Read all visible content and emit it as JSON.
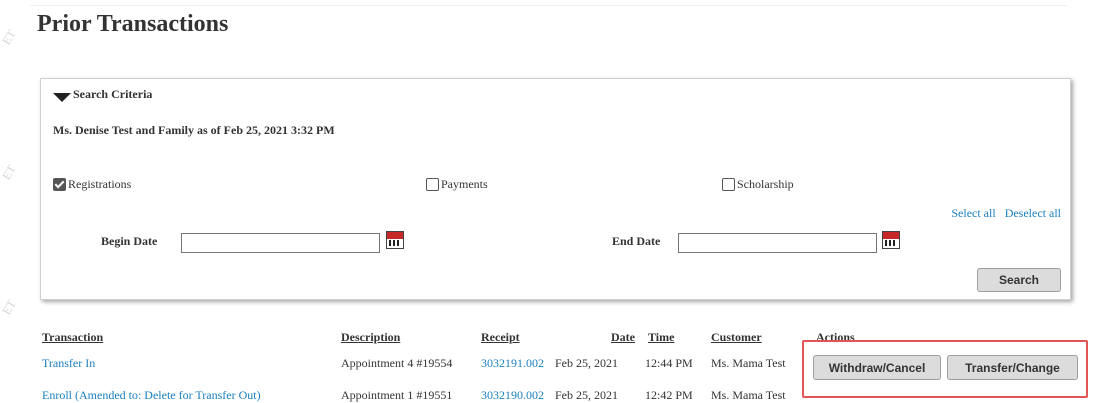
{
  "page": {
    "title": "Prior Transactions"
  },
  "watermark": {
    "text": "ET"
  },
  "search_panel": {
    "toggle_label": "Search Criteria",
    "family_text": "Ms. Denise Test and Family as of Feb 25, 2021 3:32 PM",
    "filters": [
      {
        "label": "Registrations",
        "checked": true
      },
      {
        "label": "Payments",
        "checked": false
      },
      {
        "label": "Scholarship",
        "checked": false
      }
    ],
    "select_all": "Select all",
    "deselect_all": "Deselect all",
    "begin_date_label": "Begin Date",
    "begin_date_value": "",
    "end_date_label": "End Date",
    "end_date_value": "",
    "search_button": "Search"
  },
  "table": {
    "headers": {
      "transaction": "Transaction",
      "description": "Description",
      "receipt": "Receipt",
      "date": "Date",
      "time": "Time",
      "customer": "Customer",
      "actions": "Actions"
    },
    "rows": [
      {
        "transaction": "Transfer In",
        "description": "Appointment 4 #19554",
        "receipt": "3032191.002",
        "date": "Feb 25, 2021",
        "time": "12:44 PM",
        "customer": "Ms. Mama Test"
      },
      {
        "transaction": "Enroll (Amended to: Delete for Transfer Out)",
        "description": "Appointment 1 #19551",
        "receipt": "3032190.002",
        "date": "Feb 25, 2021",
        "time": "12:42 PM",
        "customer": "Ms. Mama Test"
      }
    ]
  },
  "actions": {
    "withdraw_cancel": "Withdraw/Cancel",
    "transfer_change": "Transfer/Change"
  },
  "colors": {
    "link": "#1a7fbf",
    "highlight_border": "#e05555",
    "button_bg": "#dcdcdc"
  }
}
